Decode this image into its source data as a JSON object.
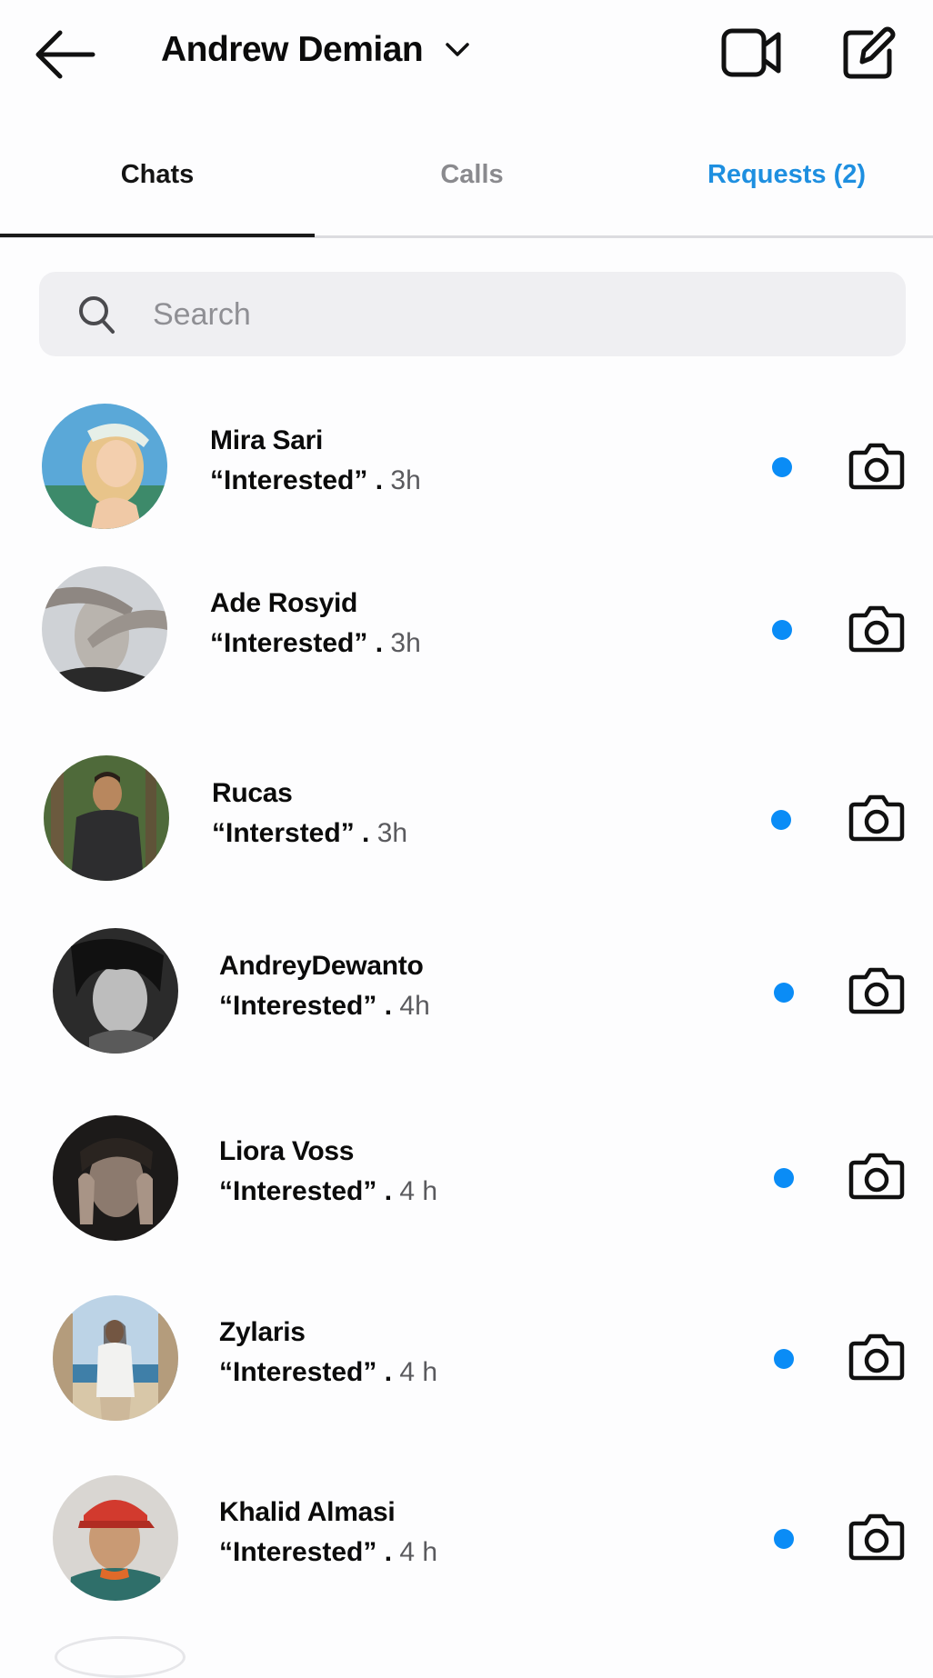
{
  "header": {
    "account_name": "Andrew Demian",
    "back_icon": "arrow-left-icon",
    "dropdown_icon": "chevron-down-icon",
    "video_icon": "video-camera-icon",
    "compose_icon": "compose-icon"
  },
  "tabs": [
    {
      "label": "Chats",
      "active": true
    },
    {
      "label": "Calls",
      "active": false
    },
    {
      "label": "Requests (2)",
      "active": false
    }
  ],
  "search": {
    "placeholder": "Search",
    "value": ""
  },
  "colors": {
    "accent": "#1e8fe0",
    "unread": "#0a8cf6",
    "search_bg": "#efeff2"
  },
  "chats": [
    {
      "name": "Mira Sari",
      "message": "“Interested” .",
      "time": "3h",
      "unread": true
    },
    {
      "name": "Ade Rosyid",
      "message": "“Interested” .",
      "time": "3h",
      "unread": true
    },
    {
      "name": "Rucas",
      "message": "“Intersted” .",
      "time": "3h",
      "unread": true
    },
    {
      "name": "AndreyDewanto",
      "message": "“Interested” .",
      "time": "4h",
      "unread": true
    },
    {
      "name": "Liora Voss",
      "message": "“Interested” .",
      "time": "4 h",
      "unread": true
    },
    {
      "name": "Zylaris",
      "message": "“Interested” .",
      "time": "4 h",
      "unread": true
    },
    {
      "name": "Khalid Almasi",
      "message": "“Interested” .",
      "time": "4 h",
      "unread": true
    }
  ]
}
